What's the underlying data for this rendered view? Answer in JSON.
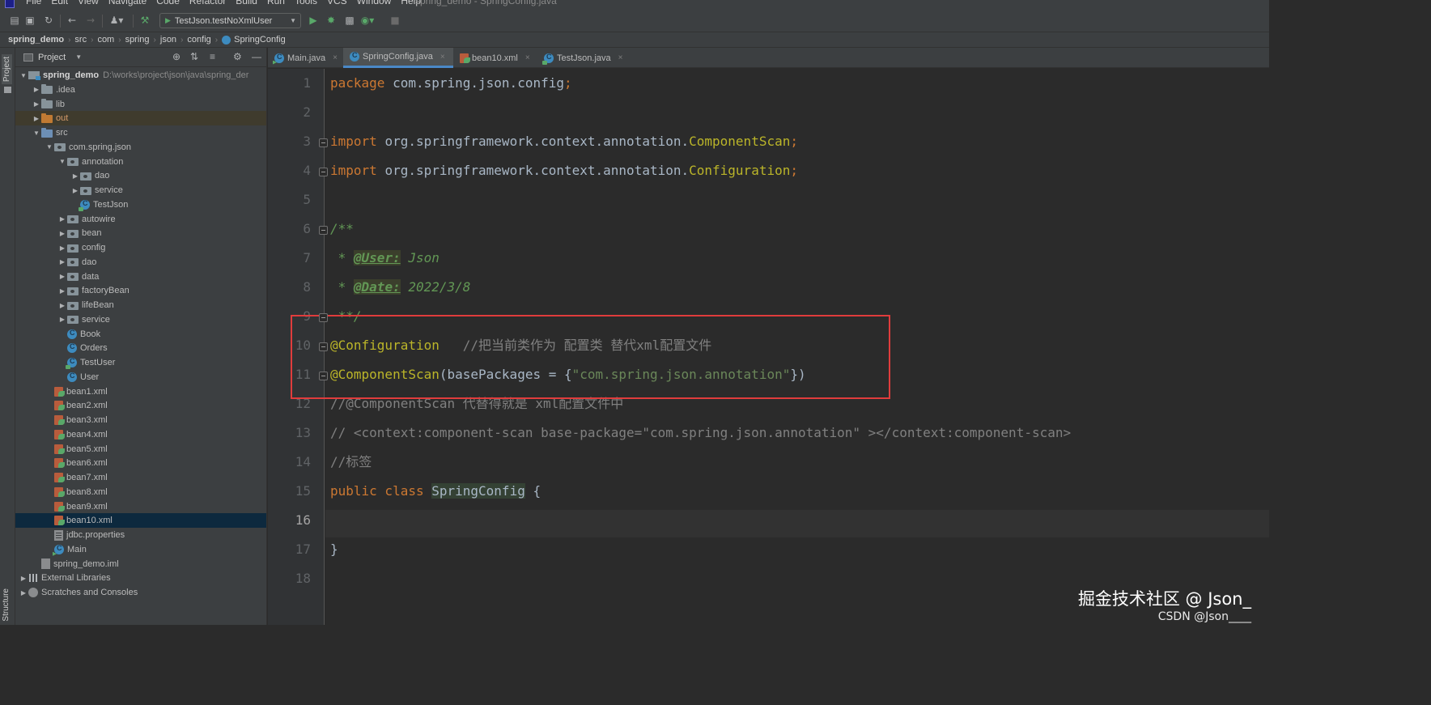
{
  "window": {
    "menu": [
      "File",
      "Edit",
      "View",
      "Navigate",
      "Code",
      "Refactor",
      "Build",
      "Run",
      "Tools",
      "VCS",
      "Window",
      "Help"
    ],
    "title": "spring_demo - SpringConfig.java"
  },
  "toolbar": {
    "run_config": "TestJson.testNoXmlUser"
  },
  "breadcrumb": [
    "spring_demo",
    "src",
    "com",
    "spring",
    "json",
    "config",
    "SpringConfig"
  ],
  "left_strip": {
    "project_label": "Project",
    "structure_label": "Structure"
  },
  "project_panel": {
    "title": "Project",
    "tree": [
      {
        "label": "spring_demo",
        "path": "D:\\works\\project\\json\\java\\spring_der",
        "depth": 0,
        "icon": "module",
        "arrow": "down",
        "bold": true
      },
      {
        "label": ".idea",
        "depth": 1,
        "icon": "folder",
        "arrow": "right"
      },
      {
        "label": "lib",
        "depth": 1,
        "icon": "folder",
        "arrow": "right"
      },
      {
        "label": "out",
        "depth": 1,
        "icon": "folder-orange",
        "arrow": "right",
        "excluded": true
      },
      {
        "label": "src",
        "depth": 1,
        "icon": "folder-blue",
        "arrow": "down"
      },
      {
        "label": "com.spring.json",
        "depth": 2,
        "icon": "package",
        "arrow": "down"
      },
      {
        "label": "annotation",
        "depth": 3,
        "icon": "package",
        "arrow": "down"
      },
      {
        "label": "dao",
        "depth": 4,
        "icon": "package",
        "arrow": "right"
      },
      {
        "label": "service",
        "depth": 4,
        "icon": "package",
        "arrow": "right"
      },
      {
        "label": "TestJson",
        "depth": 4,
        "icon": "test-class",
        "arrow": "none"
      },
      {
        "label": "autowire",
        "depth": 3,
        "icon": "package",
        "arrow": "right"
      },
      {
        "label": "bean",
        "depth": 3,
        "icon": "package",
        "arrow": "right"
      },
      {
        "label": "config",
        "depth": 3,
        "icon": "package",
        "arrow": "right"
      },
      {
        "label": "dao",
        "depth": 3,
        "icon": "package",
        "arrow": "right"
      },
      {
        "label": "data",
        "depth": 3,
        "icon": "package",
        "arrow": "right"
      },
      {
        "label": "factoryBean",
        "depth": 3,
        "icon": "package",
        "arrow": "right"
      },
      {
        "label": "lifeBean",
        "depth": 3,
        "icon": "package",
        "arrow": "right"
      },
      {
        "label": "service",
        "depth": 3,
        "icon": "package",
        "arrow": "right"
      },
      {
        "label": "Book",
        "depth": 3,
        "icon": "class",
        "arrow": "none"
      },
      {
        "label": "Orders",
        "depth": 3,
        "icon": "class",
        "arrow": "none"
      },
      {
        "label": "TestUser",
        "depth": 3,
        "icon": "test-class",
        "arrow": "none"
      },
      {
        "label": "User",
        "depth": 3,
        "icon": "class",
        "arrow": "none"
      },
      {
        "label": "bean1.xml",
        "depth": 2,
        "icon": "xml",
        "arrow": "none"
      },
      {
        "label": "bean2.xml",
        "depth": 2,
        "icon": "xml",
        "arrow": "none"
      },
      {
        "label": "bean3.xml",
        "depth": 2,
        "icon": "xml",
        "arrow": "none"
      },
      {
        "label": "bean4.xml",
        "depth": 2,
        "icon": "xml",
        "arrow": "none"
      },
      {
        "label": "bean5.xml",
        "depth": 2,
        "icon": "xml",
        "arrow": "none"
      },
      {
        "label": "bean6.xml",
        "depth": 2,
        "icon": "xml",
        "arrow": "none"
      },
      {
        "label": "bean7.xml",
        "depth": 2,
        "icon": "xml",
        "arrow": "none"
      },
      {
        "label": "bean8.xml",
        "depth": 2,
        "icon": "xml",
        "arrow": "none"
      },
      {
        "label": "bean9.xml",
        "depth": 2,
        "icon": "xml",
        "arrow": "none"
      },
      {
        "label": "bean10.xml",
        "depth": 2,
        "icon": "xml",
        "arrow": "none",
        "selected": true
      },
      {
        "label": "jdbc.properties",
        "depth": 2,
        "icon": "props",
        "arrow": "none"
      },
      {
        "label": "Main",
        "depth": 2,
        "icon": "main-class",
        "arrow": "none"
      },
      {
        "label": "spring_demo.iml",
        "depth": 1,
        "icon": "iml",
        "arrow": "none"
      },
      {
        "label": "External Libraries",
        "depth": 0,
        "icon": "lib",
        "arrow": "right"
      },
      {
        "label": "Scratches and Consoles",
        "depth": 0,
        "icon": "scratch",
        "arrow": "right"
      }
    ]
  },
  "tabs": [
    {
      "label": "Main.java",
      "icon": "main-class",
      "active": false
    },
    {
      "label": "SpringConfig.java",
      "icon": "class",
      "active": true
    },
    {
      "label": "bean10.xml",
      "icon": "xml",
      "active": false
    },
    {
      "label": "TestJson.java",
      "icon": "test-class",
      "active": false
    }
  ],
  "editor": {
    "current_line": 16,
    "lines": [
      {
        "n": 1,
        "parts": [
          [
            "kw",
            "package "
          ],
          [
            "",
            "com.spring.json.config"
          ],
          [
            "kw",
            ";"
          ]
        ]
      },
      {
        "n": 2,
        "parts": []
      },
      {
        "n": 3,
        "parts": [
          [
            "kw",
            "import "
          ],
          [
            "",
            "org.springframework.context.annotation."
          ],
          [
            "ann",
            "ComponentScan"
          ],
          [
            "kw",
            ";"
          ]
        ]
      },
      {
        "n": 4,
        "parts": [
          [
            "kw",
            "import "
          ],
          [
            "",
            "org.springframework.context.annotation."
          ],
          [
            "ann",
            "Configuration"
          ],
          [
            "kw",
            ";"
          ]
        ]
      },
      {
        "n": 5,
        "parts": []
      },
      {
        "n": 6,
        "parts": [
          [
            "doc",
            "/**"
          ]
        ]
      },
      {
        "n": 7,
        "parts": [
          [
            "doc",
            " * "
          ],
          [
            "doctag",
            "@User:"
          ],
          [
            "doc",
            " Json"
          ]
        ]
      },
      {
        "n": 8,
        "parts": [
          [
            "doc",
            " * "
          ],
          [
            "doctag",
            "@Date:"
          ],
          [
            "doc",
            " 2022/3/8"
          ]
        ]
      },
      {
        "n": 9,
        "parts": [
          [
            "doc",
            " **/"
          ]
        ]
      },
      {
        "n": 10,
        "parts": [
          [
            "ann",
            "@Configuration"
          ],
          [
            "",
            "   "
          ],
          [
            "cmt",
            "//把当前类作为 配置类 替代xml配置文件"
          ]
        ]
      },
      {
        "n": 11,
        "parts": [
          [
            "ann",
            "@ComponentScan"
          ],
          [
            "",
            "(basePackages = {"
          ],
          [
            "str",
            "\"com.spring.json.annotation\""
          ],
          [
            "",
            "})"
          ]
        ]
      },
      {
        "n": 12,
        "parts": [
          [
            "cmt",
            "//@ComponentScan 代替得就是 xml配置文件中"
          ]
        ]
      },
      {
        "n": 13,
        "parts": [
          [
            "cmt",
            "// <context:component-scan base-package=\"com.spring.json.annotation\" ></context:component-scan>"
          ]
        ]
      },
      {
        "n": 14,
        "parts": [
          [
            "cmt",
            "//标签"
          ]
        ]
      },
      {
        "n": 15,
        "parts": [
          [
            "kw",
            "public class "
          ],
          [
            "cls",
            "SpringConfig"
          ],
          [
            "",
            " {"
          ]
        ]
      },
      {
        "n": 16,
        "parts": []
      },
      {
        "n": 17,
        "parts": [
          [
            "",
            "}"
          ]
        ]
      },
      {
        "n": 18,
        "parts": []
      }
    ],
    "fold_lines": [
      3,
      4,
      6,
      9,
      10,
      11
    ]
  },
  "watermark": {
    "main": "掘金技术社区 @ Json_",
    "sub": "CSDN @Json____"
  }
}
